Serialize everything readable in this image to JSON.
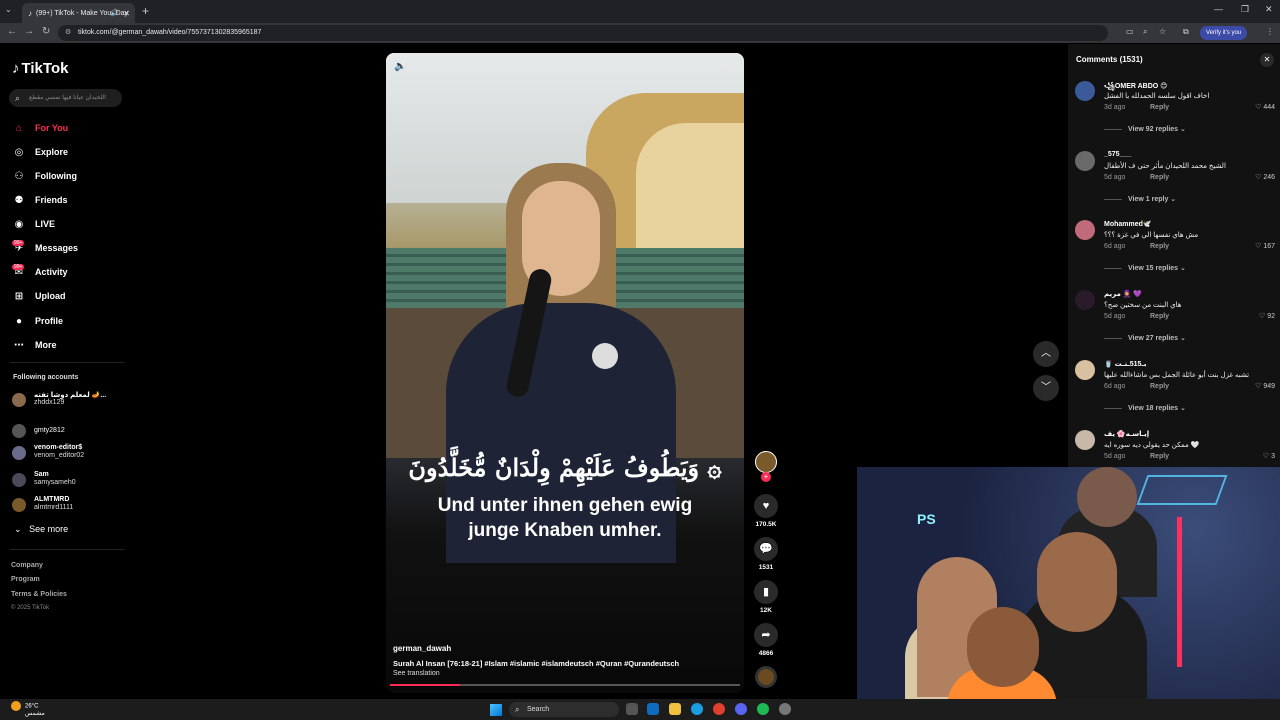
{
  "browser": {
    "tab_title": "(99+) TikTok - Make Your Day",
    "url": "tiktok.com/@german_dawah/video/7557371302835965187",
    "verify_label": "Verify it's you"
  },
  "sidebar": {
    "logo": "TikTok",
    "search_placeholder": "اللحيدان عيانا فيها نمسي مقطع",
    "nav": [
      {
        "label": "For You",
        "icon": "home-icon"
      },
      {
        "label": "Explore",
        "icon": "compass-icon"
      },
      {
        "label": "Following",
        "icon": "following-icon"
      },
      {
        "label": "Friends",
        "icon": "friends-icon"
      },
      {
        "label": "LIVE",
        "icon": "live-icon"
      },
      {
        "label": "Messages",
        "icon": "messages-icon",
        "badge": "99+"
      },
      {
        "label": "Activity",
        "icon": "activity-icon",
        "badge": "99+"
      },
      {
        "label": "Upload",
        "icon": "upload-icon"
      },
      {
        "label": "Profile",
        "icon": "profile-icon"
      },
      {
        "label": "More",
        "icon": "more-icon"
      }
    ],
    "following_title": "Following accounts",
    "accounts": [
      {
        "name": "لمعلم دوشا تفته 🪔...",
        "handle": "zhddx129"
      },
      {
        "name": "gmty2812",
        "handle": ""
      },
      {
        "name": "venom-editor$",
        "handle": "venom_editor02"
      },
      {
        "name": "Sam",
        "handle": "samysameh0"
      },
      {
        "name": "ALMTMRD",
        "handle": "almtmrd1111"
      }
    ],
    "see_more": "See more",
    "footer": [
      "Company",
      "Program",
      "Terms & Policies"
    ],
    "copyright": "© 2025 TikTok"
  },
  "video": {
    "arabic_caption": "وَيَطُوفُ عَلَيْهِمْ وِلْدَانٌ مُّخَلَّدُونَ ۞",
    "german_caption_line1": "Und unter ihnen gehen ewig",
    "german_caption_line2": "junge Knaben umher.",
    "author": "german_dawah",
    "description": "Surah Al Insan [76:18-21] #Islam #islamic #islamdeutsch #Quran #Qurandeutsch",
    "see_translation": "See translation",
    "progress_fraction": 0.2
  },
  "actions": {
    "likes": "170.5K",
    "comments": "1531",
    "saves": "12K",
    "shares": "4866"
  },
  "comments": {
    "title": "Comments (1531)",
    "items": [
      {
        "user": "꧁OMER ABDO 😊",
        "text": "اخاف اقول سلسه الحمدلله يا الفشل",
        "date": "3d ago",
        "reply": "Reply",
        "likes": "444",
        "view_replies": "View 92 replies"
      },
      {
        "user": "_575___",
        "text": "الشيخ محمد اللحيدان مأثر حتي ف الأطفال",
        "date": "5d ago",
        "reply": "Reply",
        "likes": "246",
        "view_replies": "View 1 reply"
      },
      {
        "user": "Mohammed🕊️",
        "text": "مش هاي نفسها الي في غزة ؟؟؟",
        "date": "6d ago",
        "reply": "Reply",
        "likes": "167",
        "view_replies": "View 15 replies"
      },
      {
        "user": "مريم 🧕 💜",
        "text": "هاي البنت من سختين صح؟",
        "date": "5d ago",
        "reply": "Reply",
        "likes": "92",
        "view_replies": "View 27 replies"
      },
      {
        "user": "🥤 بـ515ـنـت",
        "text": "تشبه غزل بنت أبو عائلة الجمل بس ماشاءالله عليها",
        "date": "6d ago",
        "reply": "Reply",
        "likes": "949",
        "view_replies": "View 18 replies"
      },
      {
        "user": "إيـاسـه🌸 يف",
        "text": "ممكن حد يقولي ديه سوره ايه 🤍",
        "date": "5d ago",
        "reply": "Reply",
        "likes": "3",
        "view_replies": ""
      }
    ]
  },
  "taskbar": {
    "temp": "26°C",
    "weather_desc": "مشمس",
    "search_label": "Search"
  },
  "colors": {
    "accent": "#fe2c55",
    "background": "#000000",
    "panel": "#121212"
  }
}
